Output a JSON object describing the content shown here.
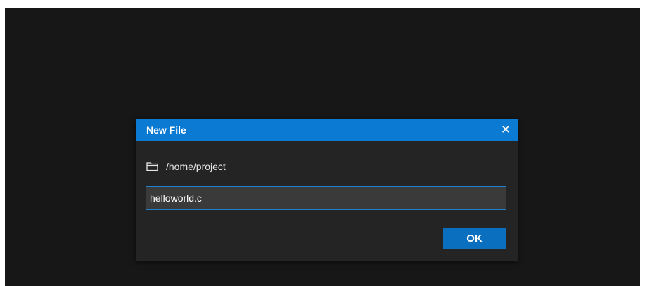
{
  "dialog": {
    "title": "New File",
    "close_glyph": "✕",
    "close_icon": "close-icon",
    "folder_icon": "folder-icon",
    "path": "/home/project",
    "filename_value": "helloworld.c",
    "ok_label": "OK"
  },
  "colors": {
    "titlebar": "#0a7ad3",
    "dialog_bg": "#242424",
    "app_bg": "#171717",
    "input_bg": "#3a3a3a",
    "input_border": "#1f7fd1",
    "ok_bg": "#0b6fbf"
  }
}
